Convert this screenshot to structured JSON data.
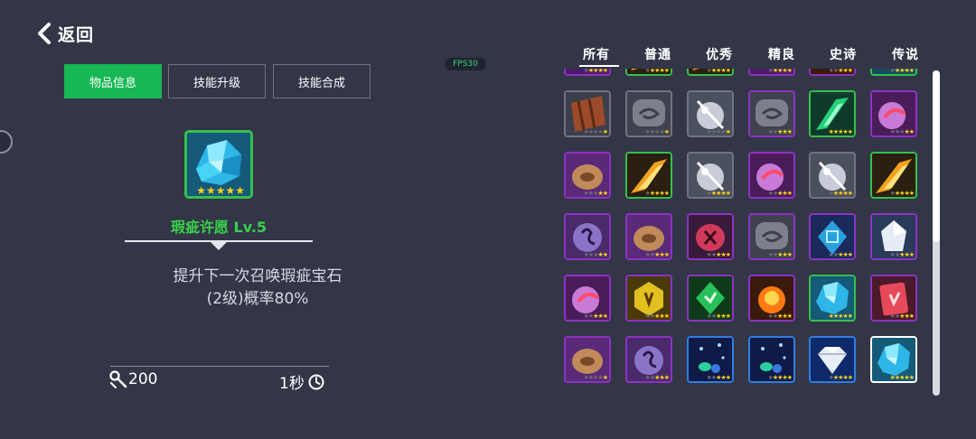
{
  "nav": {
    "back_label": "返回"
  },
  "fps_label": "FPS30",
  "left_tabs": [
    {
      "label": "物品信息",
      "active": true
    },
    {
      "label": "技能升级",
      "active": false
    },
    {
      "label": "技能合成",
      "active": false
    }
  ],
  "selected": {
    "name": "瑕疵许愿 Lv.5",
    "icon": "cyan-crystal-icon",
    "stars": 5,
    "rarity_color": "#35c04c",
    "desc_line1": "提升下一次召唤瑕疵宝石",
    "desc_line2": "(2级)概率80%",
    "cost": "200",
    "cost_icon": "wrench-icon",
    "time": "1秒",
    "time_icon": "clock-icon"
  },
  "filter_tabs": [
    "所有",
    "普通",
    "优秀",
    "精良",
    "史诗",
    "传说"
  ],
  "rarity_colors": {
    "purple": "#8d32c4",
    "gray": "#707480",
    "green": "#35c04c",
    "blue": "#2f7ee0",
    "white": "#ffffff"
  },
  "grid_items": [
    {
      "icon": "purple-orb-icon",
      "border": "purple",
      "stars": 4
    },
    {
      "icon": "fire-slash-icon",
      "border": "green",
      "stars": 4
    },
    {
      "icon": "fire-slash-icon",
      "border": "green",
      "stars": 4
    },
    {
      "icon": "purple-orb-icon",
      "border": "purple",
      "stars": 4
    },
    {
      "icon": "fire-orb-icon",
      "border": "purple",
      "stars": 3
    },
    {
      "icon": "crystal-icon",
      "border": "green",
      "stars": 4
    },
    {
      "icon": "wooden-shield-icon",
      "border": "gray",
      "stars": 1
    },
    {
      "icon": "stone-rune-icon",
      "border": "gray",
      "stars": 1
    },
    {
      "icon": "silver-orb-icon",
      "border": "gray",
      "stars": 1
    },
    {
      "icon": "stone-rune-icon",
      "border": "purple",
      "stars": 3
    },
    {
      "icon": "green-slash-icon",
      "border": "green",
      "stars": 5
    },
    {
      "icon": "pink-orb-icon",
      "border": "purple",
      "stars": 2
    },
    {
      "icon": "wooden-disc-icon",
      "border": "purple",
      "stars": 2
    },
    {
      "icon": "fire-slash-icon",
      "border": "green",
      "stars": 4
    },
    {
      "icon": "silver-orb-icon",
      "border": "gray",
      "stars": 4
    },
    {
      "icon": "pink-orb-icon",
      "border": "purple",
      "stars": 3
    },
    {
      "icon": "silver-orb-icon",
      "border": "gray",
      "stars": 4
    },
    {
      "icon": "fire-slash-icon",
      "border": "green",
      "stars": 4
    },
    {
      "icon": "purple-rune-icon",
      "border": "purple",
      "stars": 2
    },
    {
      "icon": "wooden-disc-icon",
      "border": "purple",
      "stars": 3
    },
    {
      "icon": "red-rune-icon",
      "border": "purple",
      "stars": 3
    },
    {
      "icon": "stone-rune-icon",
      "border": "purple",
      "stars": 3
    },
    {
      "icon": "blue-rune-icon",
      "border": "purple",
      "stars": 3
    },
    {
      "icon": "white-gem-icon",
      "border": "purple",
      "stars": 3
    },
    {
      "icon": "pink-orb-icon",
      "border": "purple",
      "stars": 3
    },
    {
      "icon": "gold-rune-icon",
      "border": "purple",
      "stars": 3
    },
    {
      "icon": "green-rune-icon",
      "border": "purple",
      "stars": 3
    },
    {
      "icon": "fire-orb-icon",
      "border": "purple",
      "stars": 3
    },
    {
      "icon": "cyan-crystal-icon",
      "border": "green",
      "stars": 5
    },
    {
      "icon": "red-card-icon",
      "border": "purple",
      "stars": 3
    },
    {
      "icon": "wooden-disc-icon",
      "border": "purple",
      "stars": 1
    },
    {
      "icon": "purple-rune-icon",
      "border": "purple",
      "stars": 3
    },
    {
      "icon": "blue-star-icon",
      "border": "blue",
      "stars": 3
    },
    {
      "icon": "blue-star-icon",
      "border": "blue",
      "stars": 4
    },
    {
      "icon": "diamond-icon",
      "border": "blue",
      "stars": 4
    },
    {
      "icon": "cyan-crystal-icon",
      "border": "white",
      "stars": 5
    }
  ]
}
